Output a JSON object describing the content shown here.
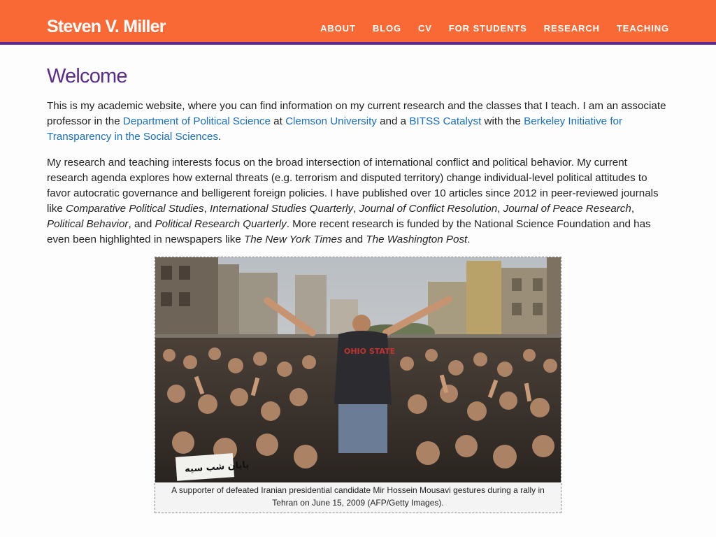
{
  "site": {
    "brand": "Steven V. Miller"
  },
  "nav": [
    "ABOUT",
    "BLOG",
    "CV",
    "FOR STUDENTS",
    "RESEARCH",
    "TEACHING"
  ],
  "page": {
    "title": "Welcome",
    "p1": {
      "t1": "This is my academic website, where you can find information on my current research and the classes that I teach. I am an associate professor in the ",
      "link_dept": "Department of Political Science",
      "t2": " at ",
      "link_clemson": "Clemson University",
      "t3": " and a ",
      "link_bitss": "BITSS Catalyst",
      "t4": " with the ",
      "link_berkeley": "Berkeley Initiative for Transparency in the Social Sciences",
      "t5": "."
    },
    "p2": {
      "t1": "My research and teaching interests focus on the broad intersection of international conflict and political behavior. My current research agenda explores how external threats (e.g. terrorism and disputed territory) change individual-level political attitudes to favor autocratic governance and belligerent foreign policies. I have published over 10 articles since 2012 in peer-reviewed journals like ",
      "j1": "Comparative Political Studies",
      "s1": ", ",
      "j2": "International Studies Quarterly",
      "s2": ", ",
      "j3": "Journal of Conflict Resolution",
      "s3": ", ",
      "j4": "Journal of Peace Research",
      "s4": ", ",
      "j5": "Political Behavior",
      "s5": ", and ",
      "j6": "Political Research Quarterly",
      "t2": ". More recent research is funded by the National Science Foundation and has even been highlighted in newspapers like ",
      "n1": "The New York Times",
      "t3": " and ",
      "n2": "The Washington Post",
      "t4": "."
    }
  },
  "figure": {
    "sign_text": "پایان شب سیه",
    "caption": "A supporter of defeated Iranian presidential candidate Mir Hossein Mousavi gestures during a rally in Tehran on June 15, 2009 (AFP/Getty Images)."
  },
  "colors": {
    "topbar": "#f96935",
    "accent_border": "#5a2d8c",
    "heading": "#5a2d8c",
    "link": "#1a6fbd"
  }
}
